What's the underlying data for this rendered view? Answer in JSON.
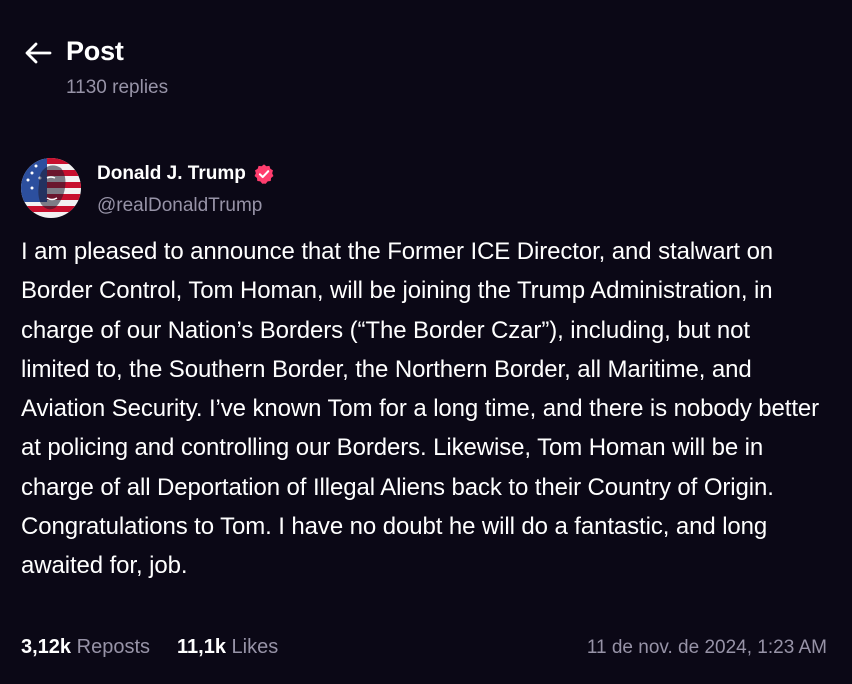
{
  "header": {
    "title": "Post",
    "replies": "1130 replies"
  },
  "author": {
    "name": "Donald J. Trump",
    "handle": "@realDonaldTrump",
    "verified_color": "#ff3d6e"
  },
  "post": {
    "text": "I am pleased to announce that the Former ICE Director, and stalwart on Border Control, Tom Homan, will be joining the Trump Administration, in charge of our Nation’s Borders (“The Border Czar”), including, but not limited to, the Southern Border, the Northern Border, all Maritime, and Aviation Security. I’ve known Tom for a long time, and there is nobody better at policing and controlling our Borders. Likewise, Tom Homan will be in charge of all Deportation of Illegal Aliens back to their Country of Origin. Congratulations to Tom. I have no doubt he will do a fantastic, and long awaited for, job."
  },
  "stats": {
    "reposts_count": "3,12k",
    "reposts_label": "Reposts",
    "likes_count": "11,1k",
    "likes_label": "Likes",
    "timestamp": "11 de nov. de 2024, 1:23 AM"
  },
  "icons": {
    "back": "arrow-left-icon",
    "verified": "verified-badge-icon"
  },
  "colors": {
    "background": "#0b0816",
    "text": "#ffffff",
    "muted": "#9793a7"
  }
}
